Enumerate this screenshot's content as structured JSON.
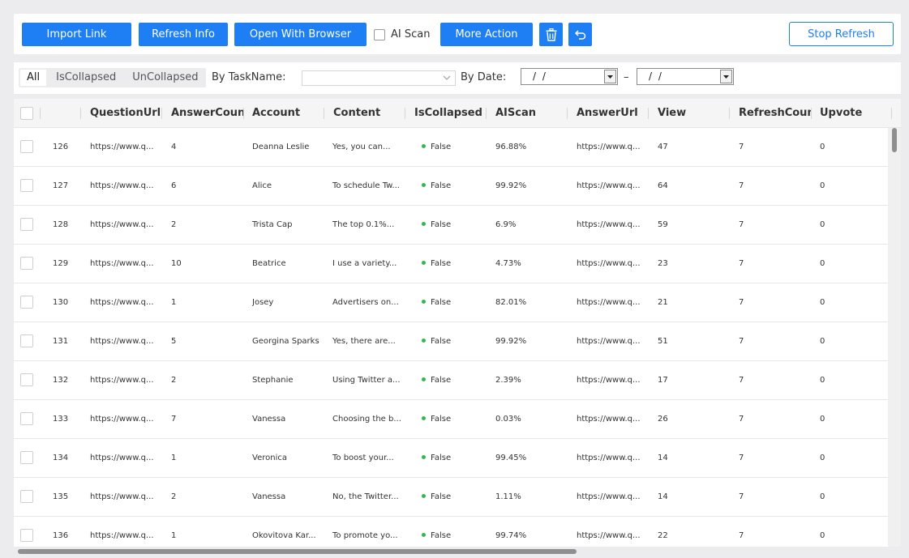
{
  "toolbar": {
    "import_link": "Import Link",
    "refresh_info": "Refresh Info",
    "open_with_browser": "Open With Browser",
    "ai_scan_label": "AI Scan",
    "more_action": "More Action",
    "stop_refresh": "Stop Refresh",
    "accent": "#1e7ef3"
  },
  "filters": {
    "tabs": [
      "All",
      "IsCollapsed",
      "UnCollapsed"
    ],
    "active_tab": "All",
    "by_taskname_label": "By TaskName:",
    "by_date_label": "By Date:",
    "date_from": "/ /",
    "date_to": "/ /",
    "date_separator": "–"
  },
  "table": {
    "columns": [
      "QuestionUrl",
      "AnswerCount",
      "Account",
      "Content",
      "IsCollapsed",
      "AIScan",
      "AnswerUrl",
      "View",
      "RefreshCount",
      "Upvote"
    ],
    "status_dot_color": "#2dbb4f",
    "rows": [
      {
        "id": "126",
        "question_url": "https://www.q...",
        "answer_count": "4",
        "account": "Deanna Leslie",
        "content": "Yes, you can...",
        "is_collapsed": "False",
        "ai_scan": "96.88%",
        "answer_url": "https://www.q...",
        "view": "47",
        "refresh_count": "7",
        "upvote": "0"
      },
      {
        "id": "127",
        "question_url": "https://www.q...",
        "answer_count": "6",
        "account": "Alice",
        "content": "To schedule Tw...",
        "is_collapsed": "False",
        "ai_scan": "99.92%",
        "answer_url": "https://www.q...",
        "view": "64",
        "refresh_count": "7",
        "upvote": "0"
      },
      {
        "id": "128",
        "question_url": "https://www.q...",
        "answer_count": "2",
        "account": "Trista Cap",
        "content": "The top 0.1%...",
        "is_collapsed": "False",
        "ai_scan": "6.9%",
        "answer_url": "https://www.q...",
        "view": "59",
        "refresh_count": "7",
        "upvote": "0"
      },
      {
        "id": "129",
        "question_url": "https://www.q...",
        "answer_count": "10",
        "account": "Beatrice",
        "content": "I use a variety...",
        "is_collapsed": "False",
        "ai_scan": "4.73%",
        "answer_url": "https://www.q...",
        "view": "23",
        "refresh_count": "7",
        "upvote": "0"
      },
      {
        "id": "130",
        "question_url": "https://www.q...",
        "answer_count": "1",
        "account": "Josey",
        "content": "Advertisers on...",
        "is_collapsed": "False",
        "ai_scan": "82.01%",
        "answer_url": "https://www.q...",
        "view": "21",
        "refresh_count": "7",
        "upvote": "0"
      },
      {
        "id": "131",
        "question_url": "https://www.q...",
        "answer_count": "5",
        "account": "Georgina Sparks",
        "content": "Yes, there are...",
        "is_collapsed": "False",
        "ai_scan": "99.92%",
        "answer_url": "https://www.q...",
        "view": "51",
        "refresh_count": "7",
        "upvote": "0"
      },
      {
        "id": "132",
        "question_url": "https://www.q...",
        "answer_count": "2",
        "account": "Stephanie",
        "content": "Using Twitter a...",
        "is_collapsed": "False",
        "ai_scan": "2.39%",
        "answer_url": "https://www.q...",
        "view": "17",
        "refresh_count": "7",
        "upvote": "0"
      },
      {
        "id": "133",
        "question_url": "https://www.q...",
        "answer_count": "7",
        "account": "Vanessa",
        "content": "Choosing the b...",
        "is_collapsed": "False",
        "ai_scan": "0.03%",
        "answer_url": "https://www.q...",
        "view": "26",
        "refresh_count": "7",
        "upvote": "0"
      },
      {
        "id": "134",
        "question_url": "https://www.q...",
        "answer_count": "1",
        "account": "Veronica",
        "content": "To boost your...",
        "is_collapsed": "False",
        "ai_scan": "99.45%",
        "answer_url": "https://www.q...",
        "view": "14",
        "refresh_count": "7",
        "upvote": "0"
      },
      {
        "id": "135",
        "question_url": "https://www.q...",
        "answer_count": "2",
        "account": "Vanessa",
        "content": "No, the Twitter...",
        "is_collapsed": "False",
        "ai_scan": "1.11%",
        "answer_url": "https://www.q...",
        "view": "14",
        "refresh_count": "7",
        "upvote": "0"
      },
      {
        "id": "136",
        "question_url": "https://www.q...",
        "answer_count": "1",
        "account": "Okovitova Kar...",
        "content": "To promote yo...",
        "is_collapsed": "False",
        "ai_scan": "99.74%",
        "answer_url": "https://www.q...",
        "view": "22",
        "refresh_count": "7",
        "upvote": "0"
      }
    ]
  }
}
